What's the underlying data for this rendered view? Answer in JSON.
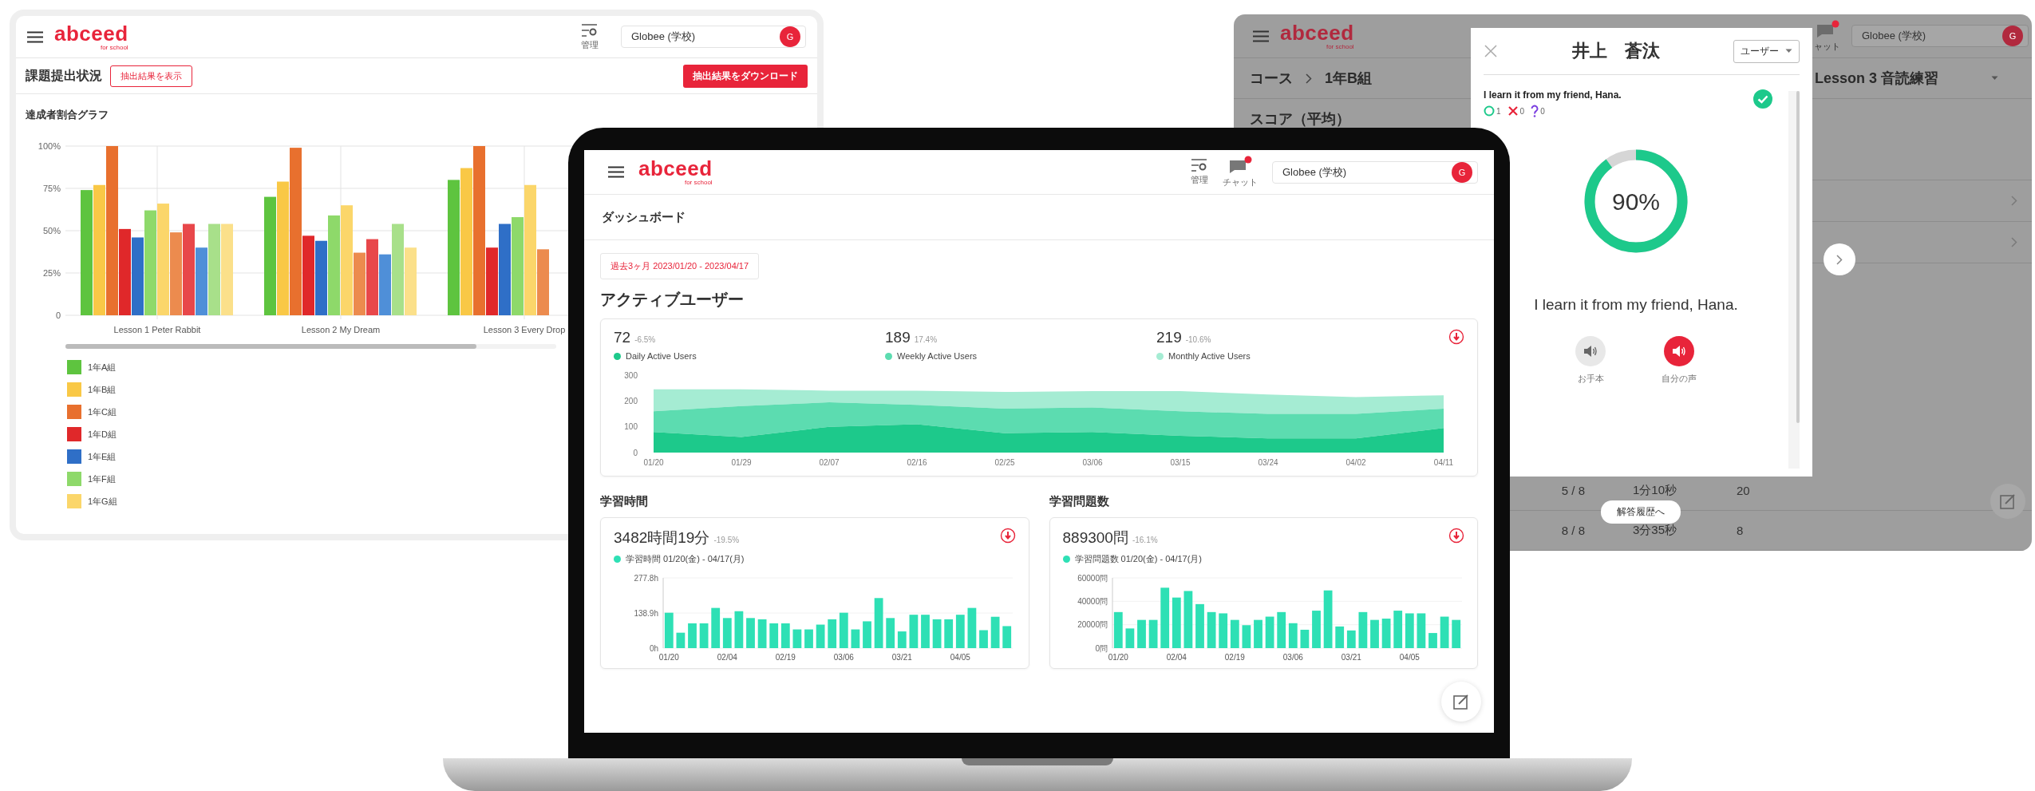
{
  "left_window": {
    "header": {
      "logo": "abceed",
      "logo_sub": "for school",
      "admin_label": "管理",
      "school_field": "Globee (学校)",
      "avatar": "G"
    },
    "toolbar": {
      "title": "課題提出状況",
      "show_results_button": "抽出結果を表示",
      "download_button": "抽出結果をダウンロード"
    },
    "section_title": "達成者割合グラフ",
    "chart_data": {
      "type": "bar",
      "grid": true,
      "categories": [
        "Lesson 1 Peter Rabbit",
        "Lesson 2 My Dream",
        "Lesson 3 Every Drop"
      ],
      "ylim": [
        0,
        100
      ],
      "yticks": [
        {
          "value": 0,
          "label": "0"
        },
        {
          "value": 25,
          "label": "25%"
        },
        {
          "value": 50,
          "label": "50%"
        },
        {
          "value": 75,
          "label": "75%"
        },
        {
          "value": 100,
          "label": "100%"
        }
      ],
      "series": [
        {
          "name": "1年A組",
          "color": "#5ec43f",
          "values": [
            74,
            70,
            80
          ]
        },
        {
          "name": "1年B組",
          "color": "#f9c846",
          "values": [
            77,
            79,
            87
          ]
        },
        {
          "name": "1年C組",
          "color": "#e8702e",
          "values": [
            100,
            99,
            100
          ]
        },
        {
          "name": "1年D組",
          "color": "#e0282a",
          "values": [
            51,
            47,
            40
          ]
        },
        {
          "name": "1年E組",
          "color": "#2f6fc7",
          "values": [
            46,
            44,
            54
          ]
        },
        {
          "name": "1年F組",
          "color": "#8ed96a",
          "values": [
            62,
            59,
            58
          ]
        },
        {
          "name": "1年G組",
          "color": "#fbd66a",
          "values": [
            66,
            65,
            77
          ]
        },
        {
          "color": "#ec8b4e",
          "values": [
            49,
            37,
            39
          ]
        },
        {
          "color": "#e8474a",
          "values": [
            54,
            45,
            null
          ]
        },
        {
          "color": "#4f8fd8",
          "values": [
            40,
            36,
            null
          ]
        },
        {
          "color": "#a8e08a",
          "values": [
            54,
            54,
            null
          ]
        },
        {
          "color": "#fbe08a",
          "values": [
            54,
            40,
            null
          ]
        }
      ]
    }
  },
  "laptop": {
    "header": {
      "logo": "abceed",
      "logo_sub": "for school",
      "admin_label": "管理",
      "chat_label": "チャット",
      "chat_badge": true,
      "school_field": "Globee (学校)",
      "avatar": "G"
    },
    "page_title": "ダッシュボード",
    "date_range": "過去3ヶ月 2023/01/20 - 2023/04/17",
    "active_users": {
      "title": "アクティブユーザー",
      "stats": [
        {
          "value": "72",
          "change": "-6.5%"
        },
        {
          "value": "189",
          "change": "17.4%"
        },
        {
          "value": "219",
          "change": "-10.6%"
        }
      ],
      "chart_data": {
        "type": "area",
        "stacked": true,
        "x": [
          "01/20",
          "01/29",
          "02/07",
          "02/16",
          "02/25",
          "03/06",
          "03/15",
          "03/24",
          "04/02",
          "04/11"
        ],
        "ylim": [
          0,
          300
        ],
        "yticks": [
          0,
          100,
          200,
          300
        ],
        "series": [
          {
            "name": "Daily Active Users",
            "color": "#1dc98b",
            "values": [
              80,
              60,
              100,
              110,
              75,
              80,
              65,
              55,
              55,
              95
            ]
          },
          {
            "name": "Weekly Active Users",
            "color": "#5cdcb0",
            "values": [
              80,
              120,
              95,
              75,
              95,
              95,
              95,
              95,
              95,
              75
            ]
          },
          {
            "name": "Monthly Active Users",
            "color": "#a5ecd3",
            "values": [
              85,
              65,
              45,
              55,
              65,
              63,
              78,
              75,
              65,
              52
            ]
          }
        ]
      }
    },
    "cards": [
      {
        "title": "学習時間",
        "total": "3482時間19分",
        "change": "-19.5%",
        "chart_data": {
          "type": "bar",
          "grid": true,
          "ylim": [
            0,
            277.8
          ],
          "yticks": [
            {
              "value": 0,
              "label": "0h"
            },
            {
              "value": 138.9,
              "label": "138.9h"
            },
            {
              "value": 277.8,
              "label": "277.8h"
            }
          ],
          "categories": [
            "01/20",
            null,
            null,
            null,
            null,
            "02/04",
            null,
            null,
            null,
            null,
            "02/19",
            null,
            null,
            null,
            null,
            "03/06",
            null,
            null,
            null,
            null,
            "03/21",
            null,
            null,
            null,
            null,
            "04/05",
            null,
            null,
            null,
            null
          ],
          "series": [
            {
              "name": "学習時間 01/20(金) - 04/17(月)",
              "color": "#2ee0b5",
              "values": [
                140,
                61,
                98,
                98,
                159,
                119,
                146,
                119,
                114,
                98,
                98,
                74,
                74,
                93,
                114,
                140,
                74,
                106,
                198,
                119,
                66,
                132,
                132,
                114,
                114,
                132,
                159,
                71,
                124,
                87
              ]
            }
          ]
        }
      },
      {
        "title": "学習問題数",
        "total": "889300問",
        "change": "-16.1%",
        "chart_data": {
          "type": "bar",
          "grid": true,
          "ylim": [
            0,
            60000
          ],
          "yticks": [
            {
              "value": 0,
              "label": "0問"
            },
            {
              "value": 20000,
              "label": "20000問"
            },
            {
              "value": 40000,
              "label": "40000問"
            },
            {
              "value": 60000,
              "label": "60000問"
            }
          ],
          "categories": [
            "01/20",
            null,
            null,
            null,
            null,
            "02/04",
            null,
            null,
            null,
            null,
            "02/19",
            null,
            null,
            null,
            null,
            "03/06",
            null,
            null,
            null,
            null,
            "03/21",
            null,
            null,
            null,
            null,
            "04/05",
            null,
            null,
            null,
            null
          ],
          "series": [
            {
              "name": "学習問題数 01/20(金) - 04/17(月)",
              "color": "#2ee0b5",
              "values": [
                30800,
                16800,
                24100,
                24100,
                51600,
                43200,
                48800,
                37600,
                30800,
                29700,
                24100,
                19600,
                24100,
                26900,
                30800,
                21300,
                15700,
                32000,
                49300,
                18500,
                15100,
                30800,
                24100,
                25200,
                32000,
                29700,
                29700,
                12900,
                26900,
                24100
              ]
            }
          ]
        }
      }
    ]
  },
  "right_window": {
    "header": {
      "logo": "abceed",
      "logo_sub": "for school",
      "chat_label": "ャット",
      "chat_badge": true,
      "school_field": "Globee (学校)",
      "avatar": "G"
    },
    "breadcrumb": [
      "コース",
      "1年B組"
    ],
    "score_title": "スコア（平均）",
    "lesson_select": "Lesson 3 音読練習",
    "rows": [
      {
        "cells": [
          "5 / 8",
          "1分10秒",
          "20"
        ]
      },
      {
        "cells": [
          "8 / 8",
          "3分35秒",
          "8"
        ]
      }
    ],
    "history_button": "解答履歴へ",
    "modal": {
      "student_name": "井上　蒼汰",
      "role_select": "ユーザー",
      "sentence": "I learn it from my friend, Hana.",
      "counts": [
        {
          "kind": "correct",
          "value": "1"
        },
        {
          "kind": "wrong",
          "value": "0"
        },
        {
          "kind": "unknown",
          "value": "0"
        }
      ],
      "completed": true,
      "score": {
        "level": 0.9,
        "label": "90%"
      },
      "transcript": "I learn it from my friend, Hana.",
      "audio_buttons": [
        {
          "kind": "model",
          "label": "お手本"
        },
        {
          "kind": "own",
          "label": "自分の声"
        }
      ]
    }
  }
}
